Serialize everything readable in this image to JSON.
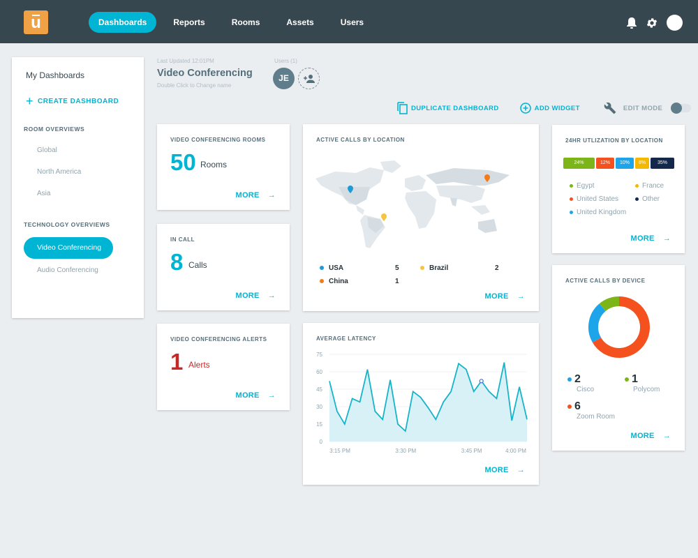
{
  "nav": {
    "logo_letter": "u",
    "items": [
      {
        "label": "Dashboards",
        "active": true
      },
      {
        "label": "Reports",
        "active": false
      },
      {
        "label": "Rooms",
        "active": false
      },
      {
        "label": "Assets",
        "active": false
      },
      {
        "label": "Users",
        "active": false
      }
    ],
    "icons": [
      "bell-icon",
      "gear-icon",
      "user-avatar"
    ]
  },
  "sidebar": {
    "title": "My Dashboards",
    "create_label": "CREATE DASHBOARD",
    "sections": [
      {
        "label": "ROOM OVERVIEWS",
        "items": [
          "Global",
          "North America",
          "Asia"
        ]
      },
      {
        "label": "TECHNOLOGY OVERVIEWS",
        "items": [
          "Video Conferencing",
          "Audio Conferencing"
        ],
        "active": "Video Conferencing"
      }
    ]
  },
  "header": {
    "last_updated": "Last Updated 12:01PM",
    "title": "Video Conferencing",
    "hint": "Double Click to Change name",
    "users_label": "Users (1)",
    "user_initials": "JE"
  },
  "actions": {
    "duplicate": "DUPLICATE DASHBOARD",
    "add_widget": "ADD WIDGET",
    "edit_mode": "EDIT MODE",
    "edit_mode_on": false
  },
  "more_label": "MORE",
  "widgets": {
    "rooms": {
      "title": "VIDEO CONFERENCING ROOMS",
      "value": "50",
      "unit": "Rooms"
    },
    "in_call": {
      "title": "IN CALL",
      "value": "8",
      "unit": "Calls"
    },
    "alerts": {
      "title": "VIDEO CONFERENCING ALERTS",
      "value": "1",
      "unit": "Alerts",
      "color": "#c62828"
    },
    "location": {
      "title": "ACTIVE CALLS BY LOCATION",
      "entries": [
        {
          "name": "USA",
          "count": "5",
          "color": "#1e9ad6"
        },
        {
          "name": "Brazil",
          "count": "2",
          "color": "#f5c542"
        },
        {
          "name": "China",
          "count": "1",
          "color": "#f07d1a"
        }
      ]
    },
    "utilization": {
      "title": "24HR UTLIZATION BY LOCATION",
      "segments": [
        {
          "label": "24%",
          "value": 24,
          "color": "#7cb518"
        },
        {
          "label": "12%",
          "value": 12,
          "color": "#f4511e"
        },
        {
          "label": "10%",
          "value": 10,
          "color": "#1ea5e9"
        },
        {
          "label": "8%",
          "value": 8,
          "color": "#f5b800"
        },
        {
          "label": "35%",
          "value": 35,
          "color": "#13284b"
        }
      ],
      "legend": [
        {
          "name": "Egypt",
          "color": "#7cb518"
        },
        {
          "name": "France",
          "color": "#f5b800"
        },
        {
          "name": "United States",
          "color": "#f4511e"
        },
        {
          "name": "Other",
          "color": "#13284b"
        },
        {
          "name": "United Kingdom",
          "color": "#1ea5e9"
        }
      ]
    },
    "devices": {
      "title": "ACTIVE CALLS BY DEVICE",
      "entries": [
        {
          "name": "Cisco",
          "count": "2",
          "color": "#1ea5e9"
        },
        {
          "name": "Polycom",
          "count": "1",
          "color": "#7cb518"
        },
        {
          "name": "Zoom Room",
          "count": "6",
          "color": "#f4511e"
        }
      ]
    },
    "latency": {
      "title": "AVERAGE LATENCY"
    }
  },
  "chart_data": {
    "type": "area",
    "title": "AVERAGE LATENCY",
    "xlabel": "",
    "ylabel": "",
    "ylim": [
      0,
      75
    ],
    "yticks": [
      "0",
      "15",
      "30",
      "45",
      "60",
      "75"
    ],
    "xticks": [
      "3:15 PM",
      "3:30 PM",
      "3:45 PM",
      "4:00 PM"
    ],
    "values": [
      52,
      26,
      15,
      37,
      34,
      62,
      26,
      19,
      53,
      15,
      9,
      43,
      38,
      29,
      19,
      34,
      43,
      67,
      62,
      43,
      52,
      43,
      37,
      68,
      18,
      47,
      19
    ],
    "highlight_index": 20,
    "grid": true,
    "color": "#17b3c9"
  }
}
